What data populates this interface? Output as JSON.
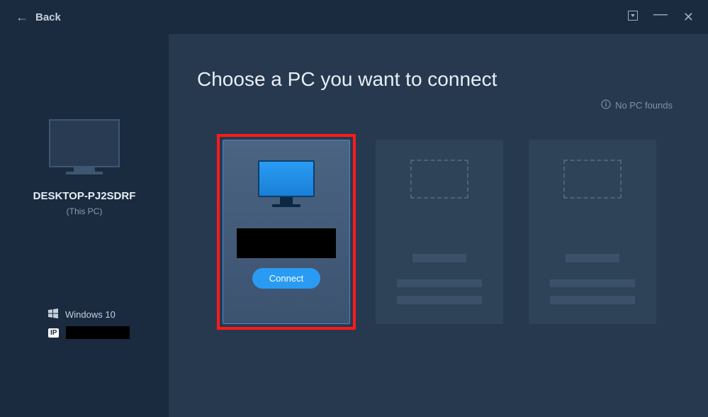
{
  "titlebar": {
    "back_label": "Back"
  },
  "sidebar": {
    "local_pc_name": "DESKTOP-PJ2SDRF",
    "this_pc_label": "(This PC)",
    "os_label": "Windows 10",
    "ip_badge": "IP"
  },
  "main": {
    "heading": "Choose a PC you want to connect",
    "hint_text": "No PC founds",
    "cards": [
      {
        "type": "available",
        "highlighted": true,
        "connect_label": "Connect"
      },
      {
        "type": "placeholder"
      },
      {
        "type": "placeholder"
      }
    ]
  }
}
